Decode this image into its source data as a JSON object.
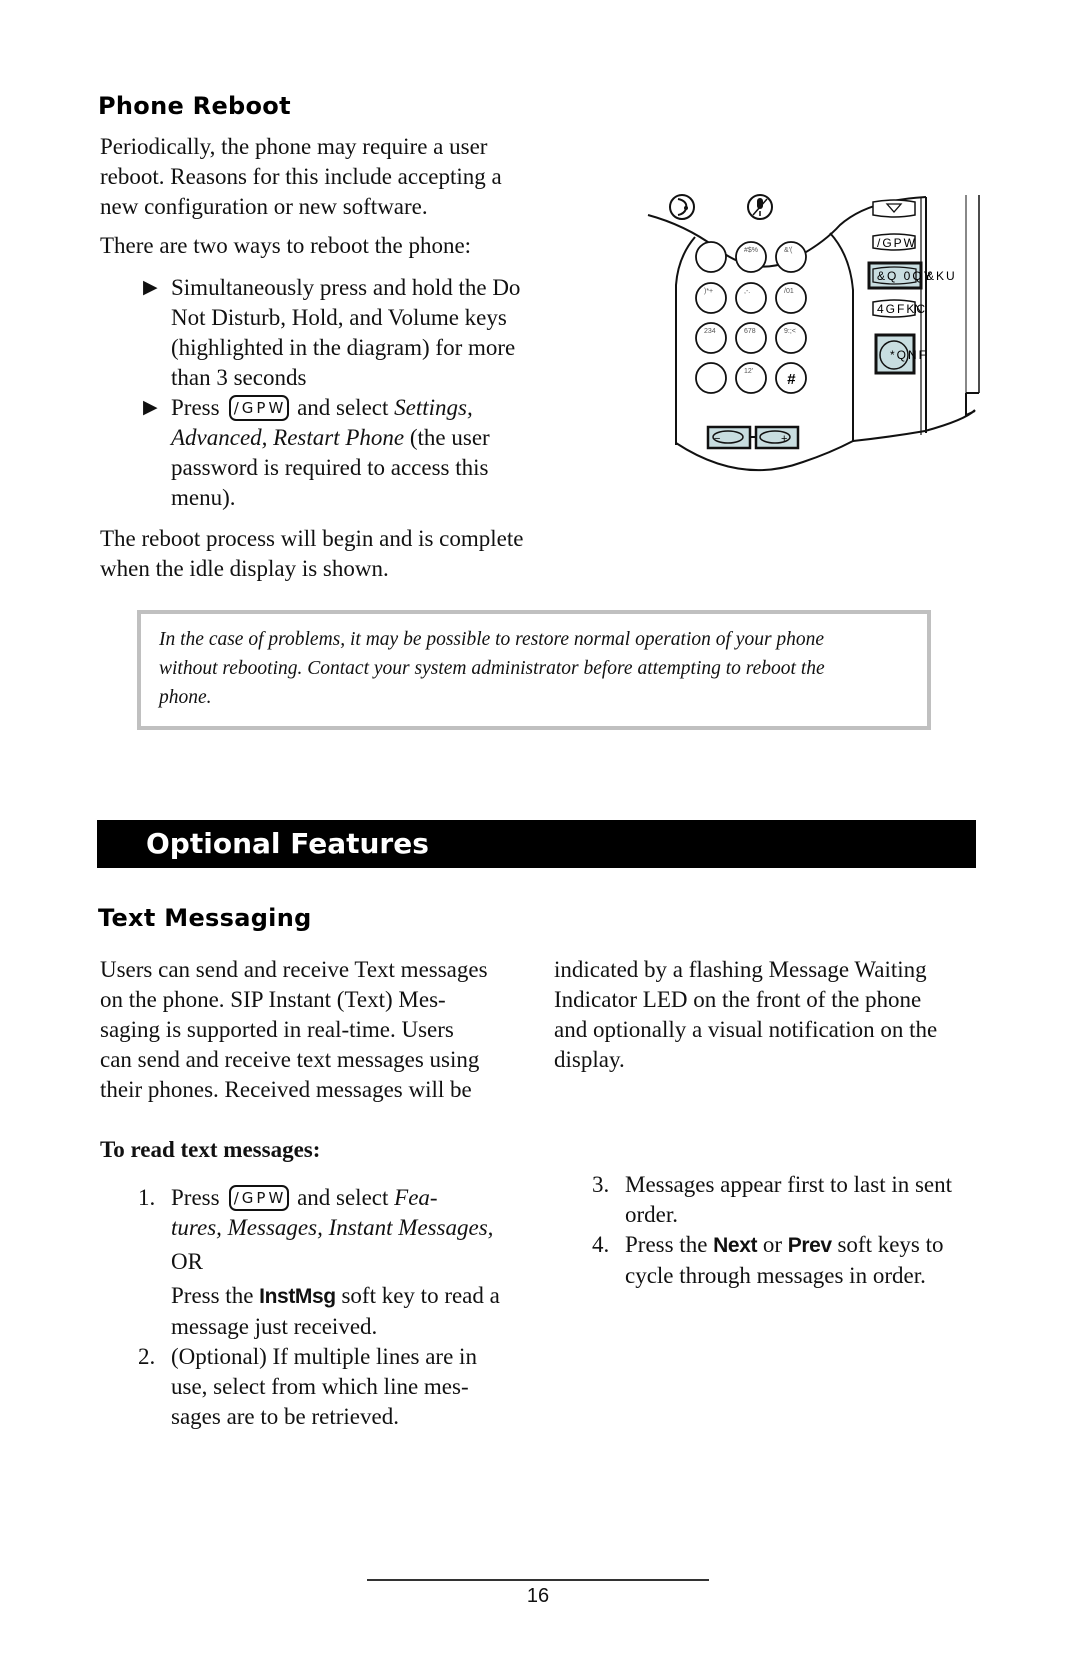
{
  "phone_reboot": {
    "heading": "Phone Reboot",
    "intro": [
      "Periodically, the phone may require a user",
      "reboot.  Reasons for this include accepting a",
      "new configuration or new software."
    ],
    "two_ways": "There are two ways to reboot the phone:",
    "bullet1": [
      "Simultaneously press and hold the Do",
      "Not Disturb, Hold, and Volume keys",
      "(highlighted in the diagram) for more",
      "than 3 seconds"
    ],
    "bullet2": {
      "press": "Press",
      "key_label": "/GPW",
      "and_select": "and select",
      "menu_1": "Settings,",
      "menu_2": "Advanced, Restart Phone",
      "rest_1": "(the user",
      "rest_2": "password is required to access this",
      "rest_3": "menu)."
    },
    "completion": [
      "The reboot process will begin and is complete",
      "when the idle display is shown."
    ],
    "bullet_icon": "right-triangle-icon"
  },
  "diagram": {
    "keypad_labels": [
      "",
      "#$%",
      "&'(",
      ")*+",
      ",-.",
      "/01",
      "234",
      "678",
      "9:;<",
      "",
      "12'",
      "#"
    ],
    "side_keys": [
      "/GPW",
      "&Q 0QY",
      "4GFKC",
      "*QNF"
    ],
    "side_key_extras": [
      "",
      "&KU",
      "N",
      "F"
    ],
    "top_icons": [
      "headset-icon",
      "mute-icon"
    ],
    "volume_keys": [
      "volume-down-icon",
      "volume-up-icon"
    ],
    "highlight_color": "#c8dde0"
  },
  "note": {
    "lines": [
      "In the case of problems, it may be possible to restore normal operation of your phone",
      "without rebooting.  Contact your system administrator before attempting to reboot the",
      "phone."
    ]
  },
  "section_banner": "Optional Features",
  "text_messaging": {
    "heading": "Text Messaging",
    "left_col": [
      "Users can send and receive Text messages",
      "on the phone.  SIP Instant (Text) Mes-",
      "saging is supported in real-time.  Users",
      "can send and receive text messages using",
      "their phones.  Received messages will be"
    ],
    "right_col": [
      "indicated by a flashing Message Waiting",
      "Indicator LED on the front of the phone",
      "and optionally a visual notification on the",
      "display."
    ],
    "subheading": "To read text messages:",
    "step1": {
      "num": "1.",
      "press": "Press",
      "key_label": "/GPW",
      "and_select": "and select",
      "menu_a": "Fea-",
      "menu_b": "tures, Messages, Instant Messages,",
      "or": "OR",
      "alt_pre": "Press the",
      "alt_key": "InstMsg",
      "alt_post": "soft key to read a",
      "alt_line2": "message just received."
    },
    "step2": {
      "num": "2.",
      "lines": [
        "(Optional)  If multiple lines are in",
        "use, select from which line mes-",
        "sages are to be retrieved."
      ]
    },
    "step3": {
      "num": "3.",
      "lines": [
        "Messages appear first to last in sent",
        "order."
      ]
    },
    "step4": {
      "num": "4.",
      "pre": "Press the",
      "key1": "Next",
      "mid": "or",
      "key2": "Prev",
      "post": "soft keys to",
      "line2": "cycle through messages in order."
    }
  },
  "footer": {
    "page_number": "16"
  }
}
